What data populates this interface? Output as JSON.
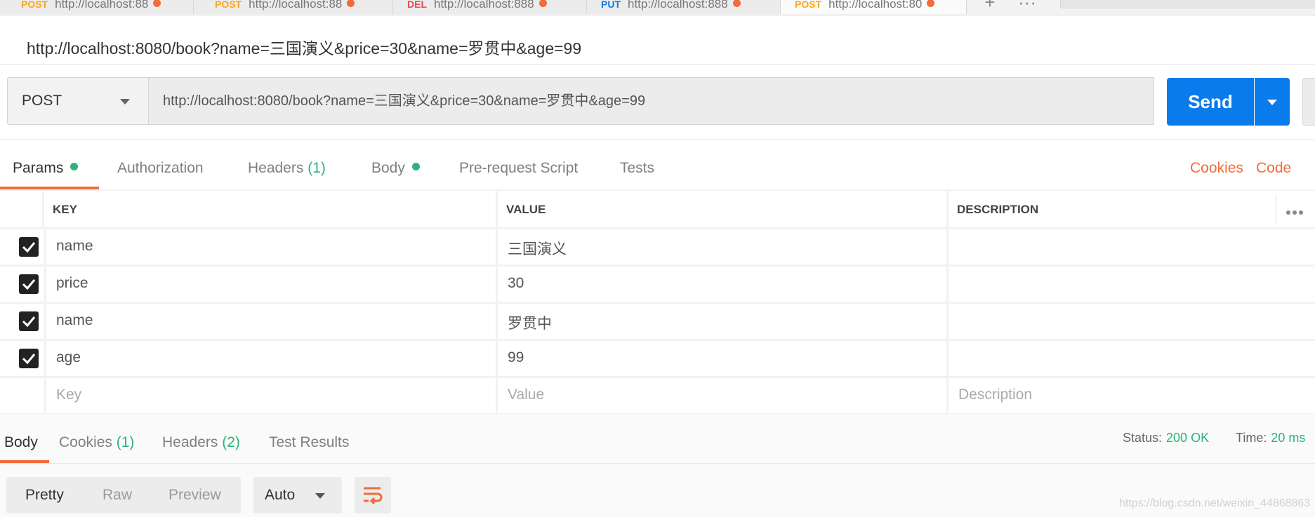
{
  "tabs": [
    {
      "method": "POST",
      "url": "http://localhost:88",
      "method_color": "#f5a623",
      "unsaved": true
    },
    {
      "method": "POST",
      "url": "http://localhost:88",
      "method_color": "#f5a623",
      "unsaved": true
    },
    {
      "method": "DEL",
      "url": "http://localhost:888",
      "method_color": "#e5484d",
      "unsaved": true
    },
    {
      "method": "PUT",
      "url": "http://localhost:888",
      "method_color": "#097bed",
      "unsaved": true
    },
    {
      "method": "POST",
      "url": "http://localhost:80",
      "method_color": "#f5a623",
      "unsaved": true,
      "active": true
    }
  ],
  "tab_actions": {
    "add_icon": "plus-icon",
    "more_icon": "more-horizontal-icon"
  },
  "request": {
    "title": "http://localhost:8080/book?name=三国演义&price=30&name=罗贯中&age=99",
    "method": "POST",
    "url": "http://localhost:8080/book?name=三国演义&price=30&name=罗贯中&age=99",
    "send_label": "Send"
  },
  "request_tabs": [
    {
      "label": "Params",
      "active": true,
      "dot": true
    },
    {
      "label": "Authorization"
    },
    {
      "label": "Headers",
      "count": "(1)"
    },
    {
      "label": "Body",
      "dot": true
    },
    {
      "label": "Pre-request Script"
    },
    {
      "label": "Tests"
    }
  ],
  "links": {
    "cookies": "Cookies",
    "code": "Code"
  },
  "params": {
    "headers": {
      "key": "KEY",
      "value": "VALUE",
      "description": "DESCRIPTION"
    },
    "rows": [
      {
        "key": "name",
        "value": "三国演义",
        "checked": true
      },
      {
        "key": "price",
        "value": "30",
        "checked": true
      },
      {
        "key": "name",
        "value": "罗贯中",
        "checked": true
      },
      {
        "key": "age",
        "value": "99",
        "checked": true
      }
    ],
    "placeholders": {
      "key": "Key",
      "value": "Value",
      "description": "Description"
    }
  },
  "response": {
    "tabs": [
      {
        "label": "Body",
        "active": true
      },
      {
        "label": "Cookies",
        "count": "(1)"
      },
      {
        "label": "Headers",
        "count": "(2)"
      },
      {
        "label": "Test Results"
      }
    ],
    "status_label": "Status:",
    "status_value": "200 OK",
    "time_label": "Time:",
    "time_value": "20 ms",
    "view_modes": [
      "Pretty",
      "Raw",
      "Preview"
    ],
    "format": "Auto",
    "wrap_icon": "wrap-lines-icon"
  },
  "watermark": "https://blog.csdn.net/weixin_44868863",
  "colors": {
    "accent": "#f26b3a",
    "send": "#097bed",
    "success": "#2bb37a"
  }
}
